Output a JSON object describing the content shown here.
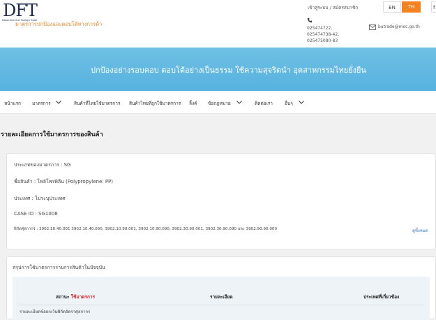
{
  "header": {
    "logo_text": "DFT",
    "logo_subtitle": "Department of Foreign Trade",
    "tagline": "มาตรการปกป้องและตอบโต้ทางการค้า",
    "login_link": "เข้าสู่ระบบ / สมัครสมาชิก",
    "lang_en": "EN",
    "lang_th": "TH",
    "lang_extra": "f",
    "phones": [
      "025474722,",
      "025474738-42,",
      "025475080-83"
    ],
    "email": "butrade@moc.go.th"
  },
  "banner": {
    "text": "ปกป้องอย่างรอบคอบ ตอบโต้อย่างเป็นธรรม ใช้ความสุจริตนำ อุตสาหกรรมไทยยั่งยืน"
  },
  "nav": {
    "items": [
      {
        "label": "หน้าแรก"
      },
      {
        "label": "มาตรการ"
      },
      {
        "label": "สินค้าที่ไทยใช้มาตรการ"
      },
      {
        "label": "สินค้าไทยที่ถูกใช้มาตรการ"
      },
      {
        "label": "ลิ้งค์"
      },
      {
        "label": "ข้อกฎหมาย"
      },
      {
        "label": "ติดต่อเรา"
      },
      {
        "label": "อื่นๆ"
      }
    ]
  },
  "section": {
    "title": "รายละเอียดการใช้มาตรการของสินค้า"
  },
  "details": {
    "measure_type": "ประเภทของมาตรการ : SG",
    "product_name": "ชื่อสินค้า : โพลิโพรพิลีน (Polypropylene: PP)",
    "country": "ประเทศ : ไม่ระบุประเทศ",
    "case_id": "CASE ID : SG1008",
    "tariff": "พิกัดศุลกากร : 3902.10.40.001 3902.10.40.090, 3902.10.90.001, 3902.10.90.090, 3902.30.90.001, 3902.30.90.090 และ 3902.90.90.000",
    "see_all": "ดูทั้งหมด"
  },
  "summary": {
    "title": "สรุปการใช้มาตรการรายการสินค้าในปัจจุบัน",
    "col_status_prefix": "สถานะ",
    "col_status_value": "ใช้มาตรการ",
    "col_detail": "รายละเอียด",
    "col_countries": "ประเทศที่เกี่ยวข้อง",
    "row_text": "รายละเอียดข้อยกเว้นพิกัดอัตราศุลกากร"
  },
  "colors": {
    "accent_orange": "#f58220",
    "banner_blue": "#5ab4df",
    "status_red": "#d71f26",
    "link_blue": "#3a7abf"
  }
}
